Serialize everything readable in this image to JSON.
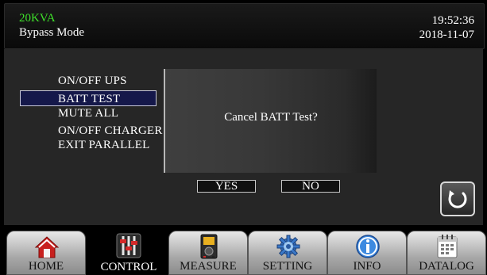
{
  "header": {
    "model": "20KVA",
    "mode": "Bypass Mode",
    "time": "19:52:36",
    "date": "2018-11-07"
  },
  "menu": {
    "items": [
      {
        "label": "ON/OFF UPS"
      },
      {
        "label": "BATT TEST"
      },
      {
        "label": "MUTE ALL"
      },
      {
        "label": "ON/OFF CHARGER"
      },
      {
        "label": "EXIT PARALLEL"
      }
    ],
    "selected": "BATT TEST"
  },
  "dialog": {
    "message": "Cancel BATT Test?",
    "yes_label": "YES",
    "no_label": "NO"
  },
  "back_button": {
    "icon": "refresh-icon"
  },
  "nav": {
    "tabs": [
      {
        "label": "HOME",
        "icon": "home-icon"
      },
      {
        "label": "CONTROL",
        "icon": "sliders-icon",
        "active": true
      },
      {
        "label": "MEASURE",
        "icon": "meter-icon"
      },
      {
        "label": "SETTING",
        "icon": "gear-icon"
      },
      {
        "label": "INFO",
        "icon": "info-icon"
      },
      {
        "label": "DATALOG",
        "icon": "calendar-icon"
      }
    ]
  },
  "colors": {
    "model_text": "#3ee02a",
    "selected_bg": "#15184a",
    "background": "#000000"
  }
}
